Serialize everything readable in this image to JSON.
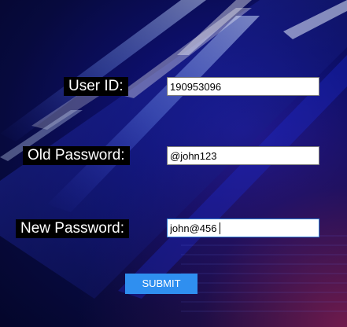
{
  "form": {
    "user_id_label": "User ID:",
    "user_id_value": "190953096",
    "old_password_label": "Old Password:",
    "old_password_value": "@john123",
    "new_password_label": "New Password:",
    "new_password_value": "john@456",
    "submit_label": "SUBMIT"
  },
  "colors": {
    "background": "#070a3e",
    "label_background": "#000000",
    "label_text": "#ffffff",
    "submit_button": "#2f8ff0",
    "focus_border": "#2f7fd6"
  }
}
